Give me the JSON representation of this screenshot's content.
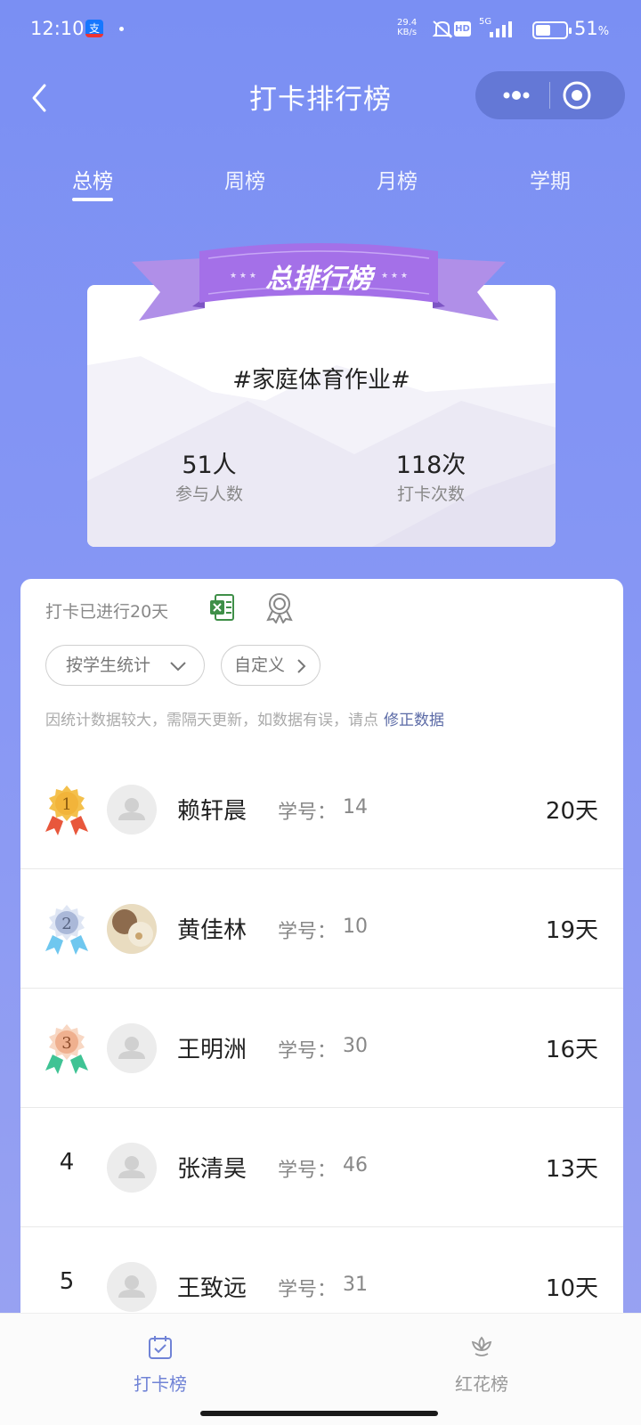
{
  "status_bar": {
    "time": "12:10",
    "app_badge": "支",
    "net_speed_value": "29.4",
    "net_speed_unit": "KB/s",
    "hd_label": "HD",
    "network_label": "5G",
    "battery_percent": 51,
    "battery_text": "51",
    "battery_unit": "%"
  },
  "header": {
    "title": "打卡排行榜"
  },
  "tabs": [
    {
      "label": "总榜",
      "active": true
    },
    {
      "label": "周榜",
      "active": false
    },
    {
      "label": "月榜",
      "active": false
    },
    {
      "label": "学期",
      "active": false
    }
  ],
  "summary": {
    "ribbon_title": "总排行榜",
    "hashtag": "#家庭体育作业#",
    "participants_value": "51人",
    "participants_label": "参与人数",
    "checkins_value": "118次",
    "checkins_label": "打卡次数"
  },
  "list_panel": {
    "days_running": "打卡已进行20天",
    "filter_label": "按学生统计",
    "custom_label": "自定义",
    "notice_text": "因统计数据较大，需隔天更新，如数据有误，请点",
    "notice_link": "修正数据",
    "student_id_label": "学号："
  },
  "rankings": [
    {
      "rank": "1",
      "name": "赖轩晨",
      "student_id": "14",
      "days": "20天"
    },
    {
      "rank": "2",
      "name": "黄佳林",
      "student_id": "10",
      "days": "19天"
    },
    {
      "rank": "3",
      "name": "王明洲",
      "student_id": "30",
      "days": "16天"
    },
    {
      "rank": "4",
      "name": "张清昊",
      "student_id": "46",
      "days": "13天"
    },
    {
      "rank": "5",
      "name": "王致远",
      "student_id": "31",
      "days": "10天"
    }
  ],
  "bottom_nav": [
    {
      "label": "打卡榜",
      "active": true
    },
    {
      "label": "红花榜",
      "active": false
    }
  ],
  "colors": {
    "accent": "#5b6aa6",
    "background": "#7a8ff3",
    "gold": "#f2b43a",
    "silver": "#aab8d8",
    "bronze": "#efb08f",
    "ribbon": "#a77cea"
  }
}
